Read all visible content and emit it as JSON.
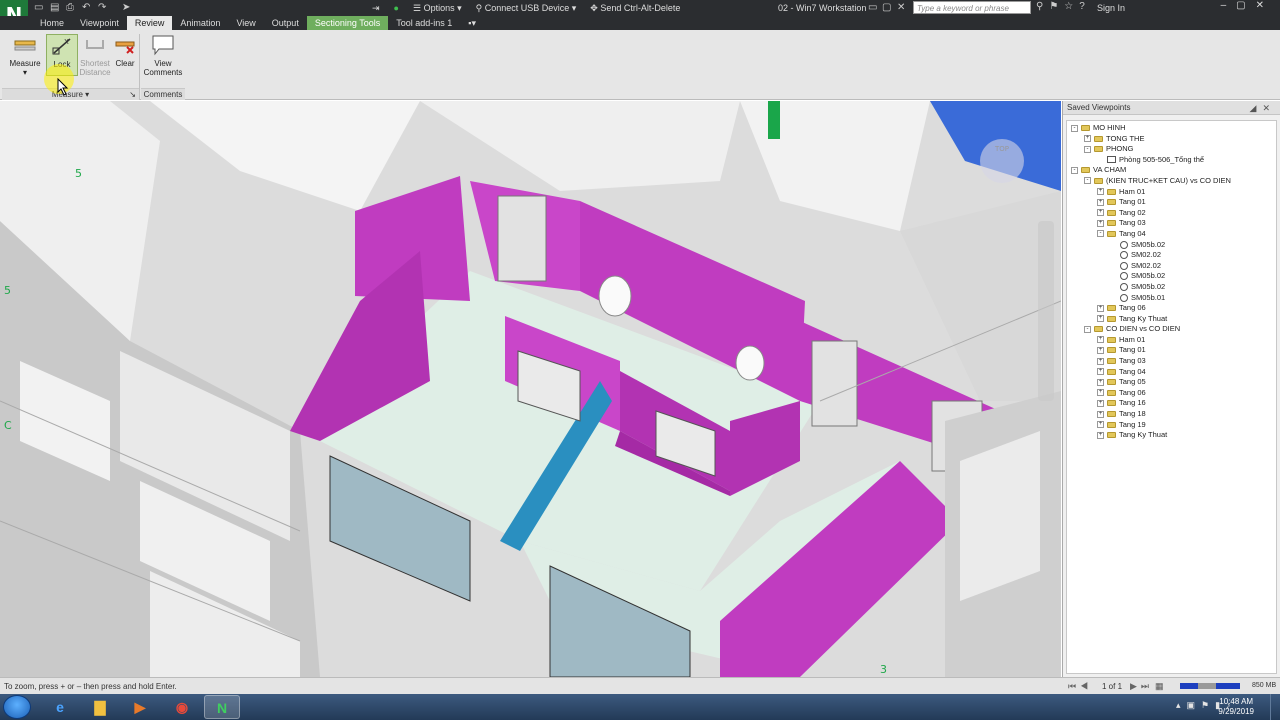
{
  "titlebar": {
    "logo": "N",
    "remote": {
      "options": "Options",
      "connect_usb": "Connect USB Device",
      "send_cad": "Send Ctrl-Alt-Delete"
    },
    "window_title": "02 - Win7 Workstation",
    "search_placeholder": "Type a keyword or phrase",
    "sign_in": "Sign In"
  },
  "tabs": [
    {
      "label": "Home"
    },
    {
      "label": "Viewpoint"
    },
    {
      "label": "Review",
      "active": true
    },
    {
      "label": "Animation"
    },
    {
      "label": "View"
    },
    {
      "label": "Output"
    },
    {
      "label": "Sectioning Tools",
      "contextual": true
    },
    {
      "label": "Tool add-ins 1"
    }
  ],
  "ribbon": {
    "measure": "Measure",
    "lock": "Lock",
    "shortest_distance_1": "Shortest",
    "shortest_distance_2": "Distance",
    "clear": "Clear",
    "view_comments_1": "View",
    "view_comments_2": "Comments",
    "panel_measure": "Measure",
    "panel_comments": "Comments"
  },
  "viewpoints": {
    "title": "Saved Viewpoints",
    "nodes": [
      {
        "label": "MO HINH",
        "level": 0,
        "type": "folder",
        "toggle": "-"
      },
      {
        "label": "TONG THE",
        "level": 1,
        "type": "folder",
        "toggle": "+"
      },
      {
        "label": "PHONG",
        "level": 1,
        "type": "folder",
        "toggle": "-"
      },
      {
        "label": "Phòng 505-506_Tổng thể",
        "level": 2,
        "type": "view"
      },
      {
        "label": "VA CHAM",
        "level": 0,
        "type": "folder",
        "toggle": "-"
      },
      {
        "label": "(KIEN TRUC+KET CAU) vs CO DIEN",
        "level": 1,
        "type": "folder",
        "toggle": "-"
      },
      {
        "label": "Ham 01",
        "level": 2,
        "type": "folder",
        "toggle": "+"
      },
      {
        "label": "Tang 01",
        "level": 2,
        "type": "folder",
        "toggle": "+"
      },
      {
        "label": "Tang 02",
        "level": 2,
        "type": "folder",
        "toggle": "+"
      },
      {
        "label": "Tang 03",
        "level": 2,
        "type": "folder",
        "toggle": "+"
      },
      {
        "label": "Tang 04",
        "level": 2,
        "type": "folder",
        "toggle": "-"
      },
      {
        "label": "SM05b.02",
        "level": 3,
        "type": "clash"
      },
      {
        "label": "SM02.02",
        "level": 3,
        "type": "clash"
      },
      {
        "label": "SM02.02",
        "level": 3,
        "type": "clash"
      },
      {
        "label": "SM05b.02",
        "level": 3,
        "type": "clash"
      },
      {
        "label": "SM05b.02",
        "level": 3,
        "type": "clash"
      },
      {
        "label": "SM05b.01",
        "level": 3,
        "type": "clash"
      },
      {
        "label": "Tang 06",
        "level": 2,
        "type": "folder",
        "toggle": "+"
      },
      {
        "label": "Tang Ky Thuat",
        "level": 2,
        "type": "folder",
        "toggle": "+"
      },
      {
        "label": "CO DIEN vs CO DIEN",
        "level": 1,
        "type": "folder",
        "toggle": "-"
      },
      {
        "label": "Ham 01",
        "level": 2,
        "type": "folder",
        "toggle": "+"
      },
      {
        "label": "Tang 01",
        "level": 2,
        "type": "folder",
        "toggle": "+"
      },
      {
        "label": "Tang 03",
        "level": 2,
        "type": "folder",
        "toggle": "+"
      },
      {
        "label": "Tang 04",
        "level": 2,
        "type": "folder",
        "toggle": "+"
      },
      {
        "label": "Tang 05",
        "level": 2,
        "type": "folder",
        "toggle": "+"
      },
      {
        "label": "Tang 06",
        "level": 2,
        "type": "folder",
        "toggle": "+"
      },
      {
        "label": "Tang 16",
        "level": 2,
        "type": "folder",
        "toggle": "+"
      },
      {
        "label": "Tang 18",
        "level": 2,
        "type": "folder",
        "toggle": "+"
      },
      {
        "label": "Tang 19",
        "level": 2,
        "type": "folder",
        "toggle": "+"
      },
      {
        "label": "Tang Ky Thuat",
        "level": 2,
        "type": "folder",
        "toggle": "+"
      }
    ]
  },
  "viewport": {
    "grid_labels": [
      "5",
      "5",
      "C",
      "3"
    ],
    "colors": {
      "magenta": "#c03cc0",
      "floor": "#dfeee6",
      "glass": "#2a8fc0",
      "sky": "#3a6bd8"
    }
  },
  "status": {
    "message": "To zoom, press + or – then press and hold Enter.",
    "pages": "1 of 1",
    "memory": "850 MB"
  },
  "taskbar": {
    "time": "10:48 AM",
    "date": "9/29/2019",
    "active_app": "N"
  }
}
